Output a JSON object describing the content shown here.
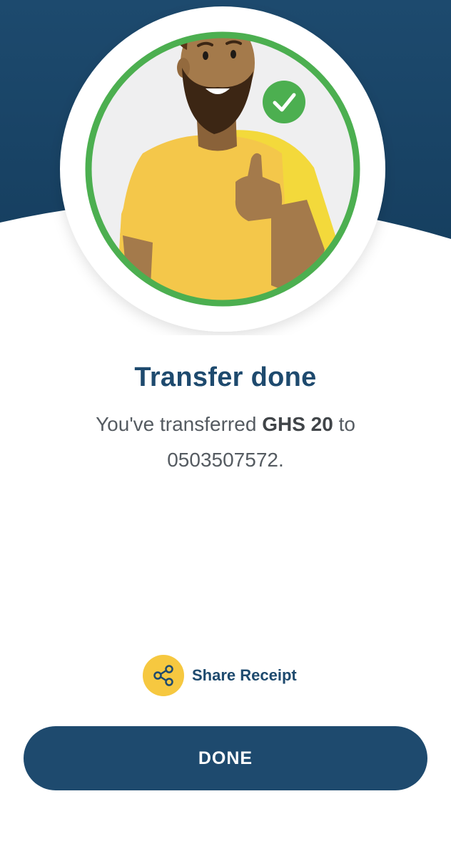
{
  "header": {
    "bg_color": "#1d4a6e",
    "illustration": "thumbs-up-person",
    "badge_icon": "checkmark-icon",
    "ring_color": "#4caf50"
  },
  "result": {
    "title": "Transfer done",
    "message_prefix": "You've transferred ",
    "amount": "GHS 20",
    "message_middle": " to ",
    "recipient": "0503507572",
    "message_suffix": "."
  },
  "share": {
    "icon": "share-icon",
    "label": "Share Receipt"
  },
  "done_button": {
    "label": "DONE"
  }
}
